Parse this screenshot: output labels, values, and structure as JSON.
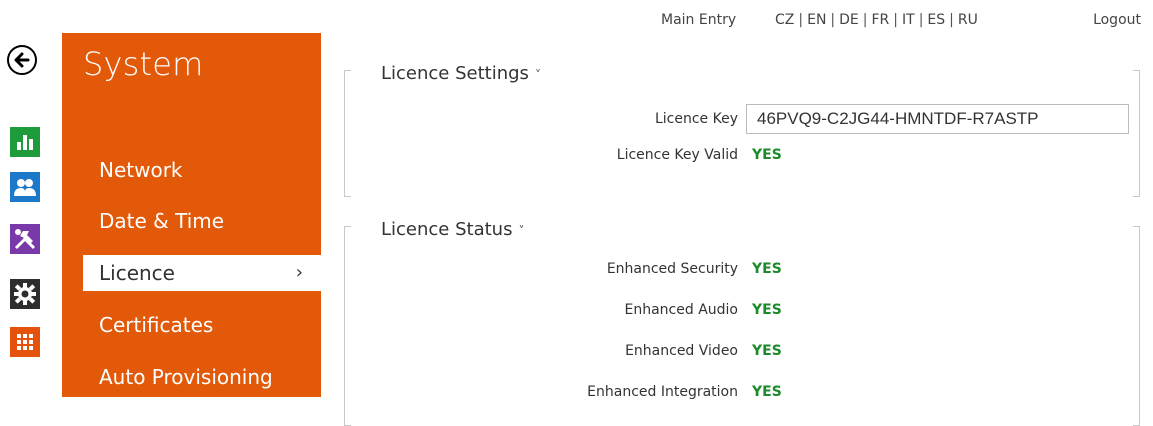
{
  "topbar": {
    "main_entry": "Main Entry",
    "languages": [
      "CZ",
      "EN",
      "DE",
      "FR",
      "IT",
      "ES",
      "RU"
    ],
    "logout": "Logout"
  },
  "rail": {
    "icons": [
      "back-arrow-icon",
      "stats-icon",
      "users-icon",
      "tools-icon",
      "gear-icon",
      "grid-icon"
    ]
  },
  "sysmenu": {
    "title": "System",
    "items": [
      {
        "label": "Network"
      },
      {
        "label": "Date & Time"
      },
      {
        "label": "Licence",
        "active": true
      },
      {
        "label": "Certificates"
      },
      {
        "label": "Auto Provisioning"
      }
    ],
    "active_chevron": "›"
  },
  "licence_settings": {
    "title": "Licence Settings",
    "caret": "˅",
    "key_label": "Licence Key",
    "key_value": "46PVQ9-C2JG44-HMNTDF-R7ASTP",
    "valid_label": "Licence Key Valid",
    "valid_value": "YES"
  },
  "licence_status": {
    "title": "Licence Status",
    "caret": "˅",
    "rows": [
      {
        "label": "Enhanced Security",
        "value": "YES"
      },
      {
        "label": "Enhanced Audio",
        "value": "YES"
      },
      {
        "label": "Enhanced Video",
        "value": "YES"
      },
      {
        "label": "Enhanced Integration",
        "value": "YES"
      }
    ]
  },
  "colors": {
    "menu_orange": "#e25a09",
    "yes_green": "#1a8a2a"
  }
}
